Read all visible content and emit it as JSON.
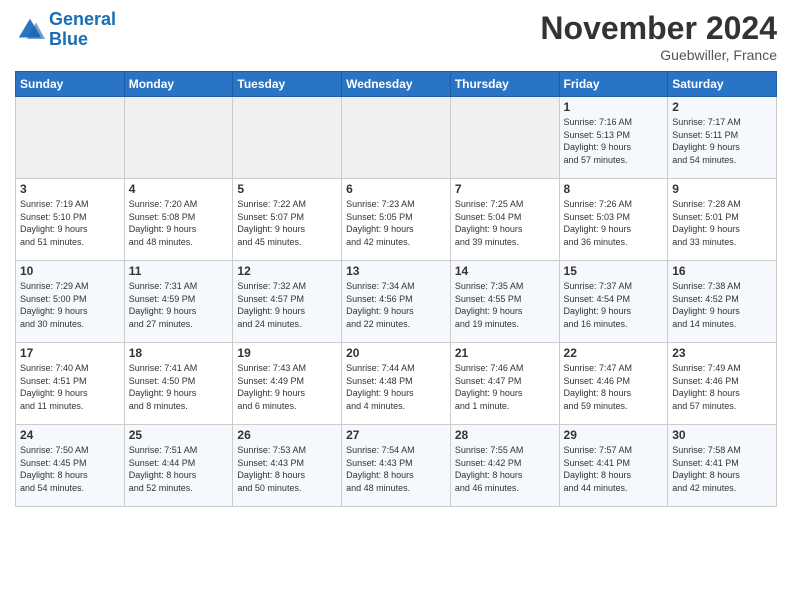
{
  "logo": {
    "line1": "General",
    "line2": "Blue"
  },
  "title": "November 2024",
  "location": "Guebwiller, France",
  "days_of_week": [
    "Sunday",
    "Monday",
    "Tuesday",
    "Wednesday",
    "Thursday",
    "Friday",
    "Saturday"
  ],
  "weeks": [
    [
      {
        "day": "",
        "info": ""
      },
      {
        "day": "",
        "info": ""
      },
      {
        "day": "",
        "info": ""
      },
      {
        "day": "",
        "info": ""
      },
      {
        "day": "",
        "info": ""
      },
      {
        "day": "1",
        "info": "Sunrise: 7:16 AM\nSunset: 5:13 PM\nDaylight: 9 hours\nand 57 minutes."
      },
      {
        "day": "2",
        "info": "Sunrise: 7:17 AM\nSunset: 5:11 PM\nDaylight: 9 hours\nand 54 minutes."
      }
    ],
    [
      {
        "day": "3",
        "info": "Sunrise: 7:19 AM\nSunset: 5:10 PM\nDaylight: 9 hours\nand 51 minutes."
      },
      {
        "day": "4",
        "info": "Sunrise: 7:20 AM\nSunset: 5:08 PM\nDaylight: 9 hours\nand 48 minutes."
      },
      {
        "day": "5",
        "info": "Sunrise: 7:22 AM\nSunset: 5:07 PM\nDaylight: 9 hours\nand 45 minutes."
      },
      {
        "day": "6",
        "info": "Sunrise: 7:23 AM\nSunset: 5:05 PM\nDaylight: 9 hours\nand 42 minutes."
      },
      {
        "day": "7",
        "info": "Sunrise: 7:25 AM\nSunset: 5:04 PM\nDaylight: 9 hours\nand 39 minutes."
      },
      {
        "day": "8",
        "info": "Sunrise: 7:26 AM\nSunset: 5:03 PM\nDaylight: 9 hours\nand 36 minutes."
      },
      {
        "day": "9",
        "info": "Sunrise: 7:28 AM\nSunset: 5:01 PM\nDaylight: 9 hours\nand 33 minutes."
      }
    ],
    [
      {
        "day": "10",
        "info": "Sunrise: 7:29 AM\nSunset: 5:00 PM\nDaylight: 9 hours\nand 30 minutes."
      },
      {
        "day": "11",
        "info": "Sunrise: 7:31 AM\nSunset: 4:59 PM\nDaylight: 9 hours\nand 27 minutes."
      },
      {
        "day": "12",
        "info": "Sunrise: 7:32 AM\nSunset: 4:57 PM\nDaylight: 9 hours\nand 24 minutes."
      },
      {
        "day": "13",
        "info": "Sunrise: 7:34 AM\nSunset: 4:56 PM\nDaylight: 9 hours\nand 22 minutes."
      },
      {
        "day": "14",
        "info": "Sunrise: 7:35 AM\nSunset: 4:55 PM\nDaylight: 9 hours\nand 19 minutes."
      },
      {
        "day": "15",
        "info": "Sunrise: 7:37 AM\nSunset: 4:54 PM\nDaylight: 9 hours\nand 16 minutes."
      },
      {
        "day": "16",
        "info": "Sunrise: 7:38 AM\nSunset: 4:52 PM\nDaylight: 9 hours\nand 14 minutes."
      }
    ],
    [
      {
        "day": "17",
        "info": "Sunrise: 7:40 AM\nSunset: 4:51 PM\nDaylight: 9 hours\nand 11 minutes."
      },
      {
        "day": "18",
        "info": "Sunrise: 7:41 AM\nSunset: 4:50 PM\nDaylight: 9 hours\nand 8 minutes."
      },
      {
        "day": "19",
        "info": "Sunrise: 7:43 AM\nSunset: 4:49 PM\nDaylight: 9 hours\nand 6 minutes."
      },
      {
        "day": "20",
        "info": "Sunrise: 7:44 AM\nSunset: 4:48 PM\nDaylight: 9 hours\nand 4 minutes."
      },
      {
        "day": "21",
        "info": "Sunrise: 7:46 AM\nSunset: 4:47 PM\nDaylight: 9 hours\nand 1 minute."
      },
      {
        "day": "22",
        "info": "Sunrise: 7:47 AM\nSunset: 4:46 PM\nDaylight: 8 hours\nand 59 minutes."
      },
      {
        "day": "23",
        "info": "Sunrise: 7:49 AM\nSunset: 4:46 PM\nDaylight: 8 hours\nand 57 minutes."
      }
    ],
    [
      {
        "day": "24",
        "info": "Sunrise: 7:50 AM\nSunset: 4:45 PM\nDaylight: 8 hours\nand 54 minutes."
      },
      {
        "day": "25",
        "info": "Sunrise: 7:51 AM\nSunset: 4:44 PM\nDaylight: 8 hours\nand 52 minutes."
      },
      {
        "day": "26",
        "info": "Sunrise: 7:53 AM\nSunset: 4:43 PM\nDaylight: 8 hours\nand 50 minutes."
      },
      {
        "day": "27",
        "info": "Sunrise: 7:54 AM\nSunset: 4:43 PM\nDaylight: 8 hours\nand 48 minutes."
      },
      {
        "day": "28",
        "info": "Sunrise: 7:55 AM\nSunset: 4:42 PM\nDaylight: 8 hours\nand 46 minutes."
      },
      {
        "day": "29",
        "info": "Sunrise: 7:57 AM\nSunset: 4:41 PM\nDaylight: 8 hours\nand 44 minutes."
      },
      {
        "day": "30",
        "info": "Sunrise: 7:58 AM\nSunset: 4:41 PM\nDaylight: 8 hours\nand 42 minutes."
      }
    ]
  ]
}
